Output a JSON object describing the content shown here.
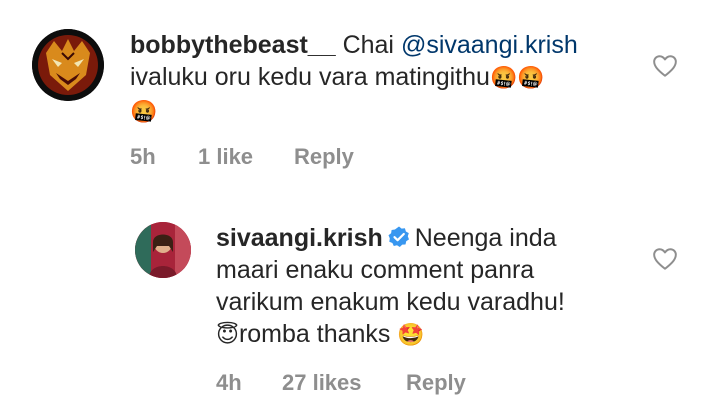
{
  "comments": [
    {
      "username": "bobbythebeast__",
      "line1_prefix": "Chai ",
      "mention": "@sivaangi.krish",
      "line2": "ivaluku oru kedu vara matingithu",
      "line2_emoji": "🤬🤬",
      "line3_emoji": "🤬",
      "time": "5h",
      "likes": "1 like",
      "reply": "Reply"
    },
    {
      "username": "sivaangi.krish",
      "verified": true,
      "line1": "Neenga inda",
      "line2": "maari enaku comment panra",
      "line3": "varikum enakum kedu varadhu!",
      "line4_emoji_start": "😇",
      "line4_text": "romba thanks",
      "line4_emoji_end": "🤩",
      "time": "4h",
      "likes": "27 likes",
      "reply": "Reply"
    }
  ],
  "colors": {
    "text": "#262626",
    "meta": "#8e8e8e",
    "mention": "#00376b",
    "verified": "#3897f0"
  },
  "icons": {
    "like": "heart-outline-icon",
    "verified": "verified-badge-icon"
  }
}
